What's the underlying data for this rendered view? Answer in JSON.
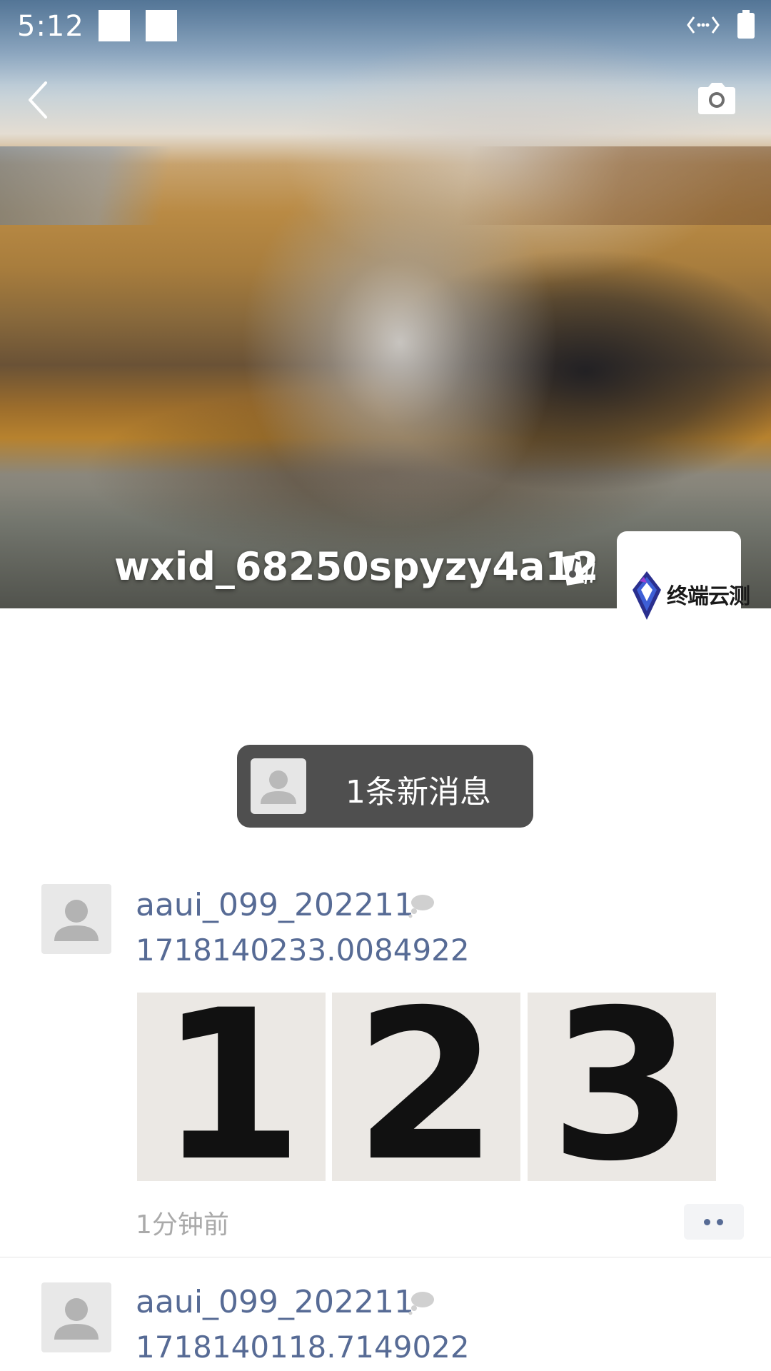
{
  "status_bar": {
    "time": "5:12",
    "icons": [
      "notification-square",
      "notification-square",
      "data-sync-icon",
      "battery-icon"
    ]
  },
  "nav": {
    "back_icon": "chevron-left-icon",
    "camera_icon": "camera-icon"
  },
  "profile": {
    "name": "wxid_68250spyzy4a12",
    "gender_icon": "gender-icon",
    "avatar_logo_text": "终端云测"
  },
  "new_messages": {
    "label": "1条新消息"
  },
  "posts": [
    {
      "author": "aaui_099_202211",
      "content": "1718140233.0084922",
      "photos": [
        "1",
        "2",
        "3"
      ],
      "time": "1分钟前"
    },
    {
      "author": "aaui_099_202211",
      "content": "1718140118.7149022"
    }
  ],
  "colors": {
    "link": "#576b95",
    "pill_bg": "#4f4f4f",
    "time_gray": "#aaaaaa"
  }
}
